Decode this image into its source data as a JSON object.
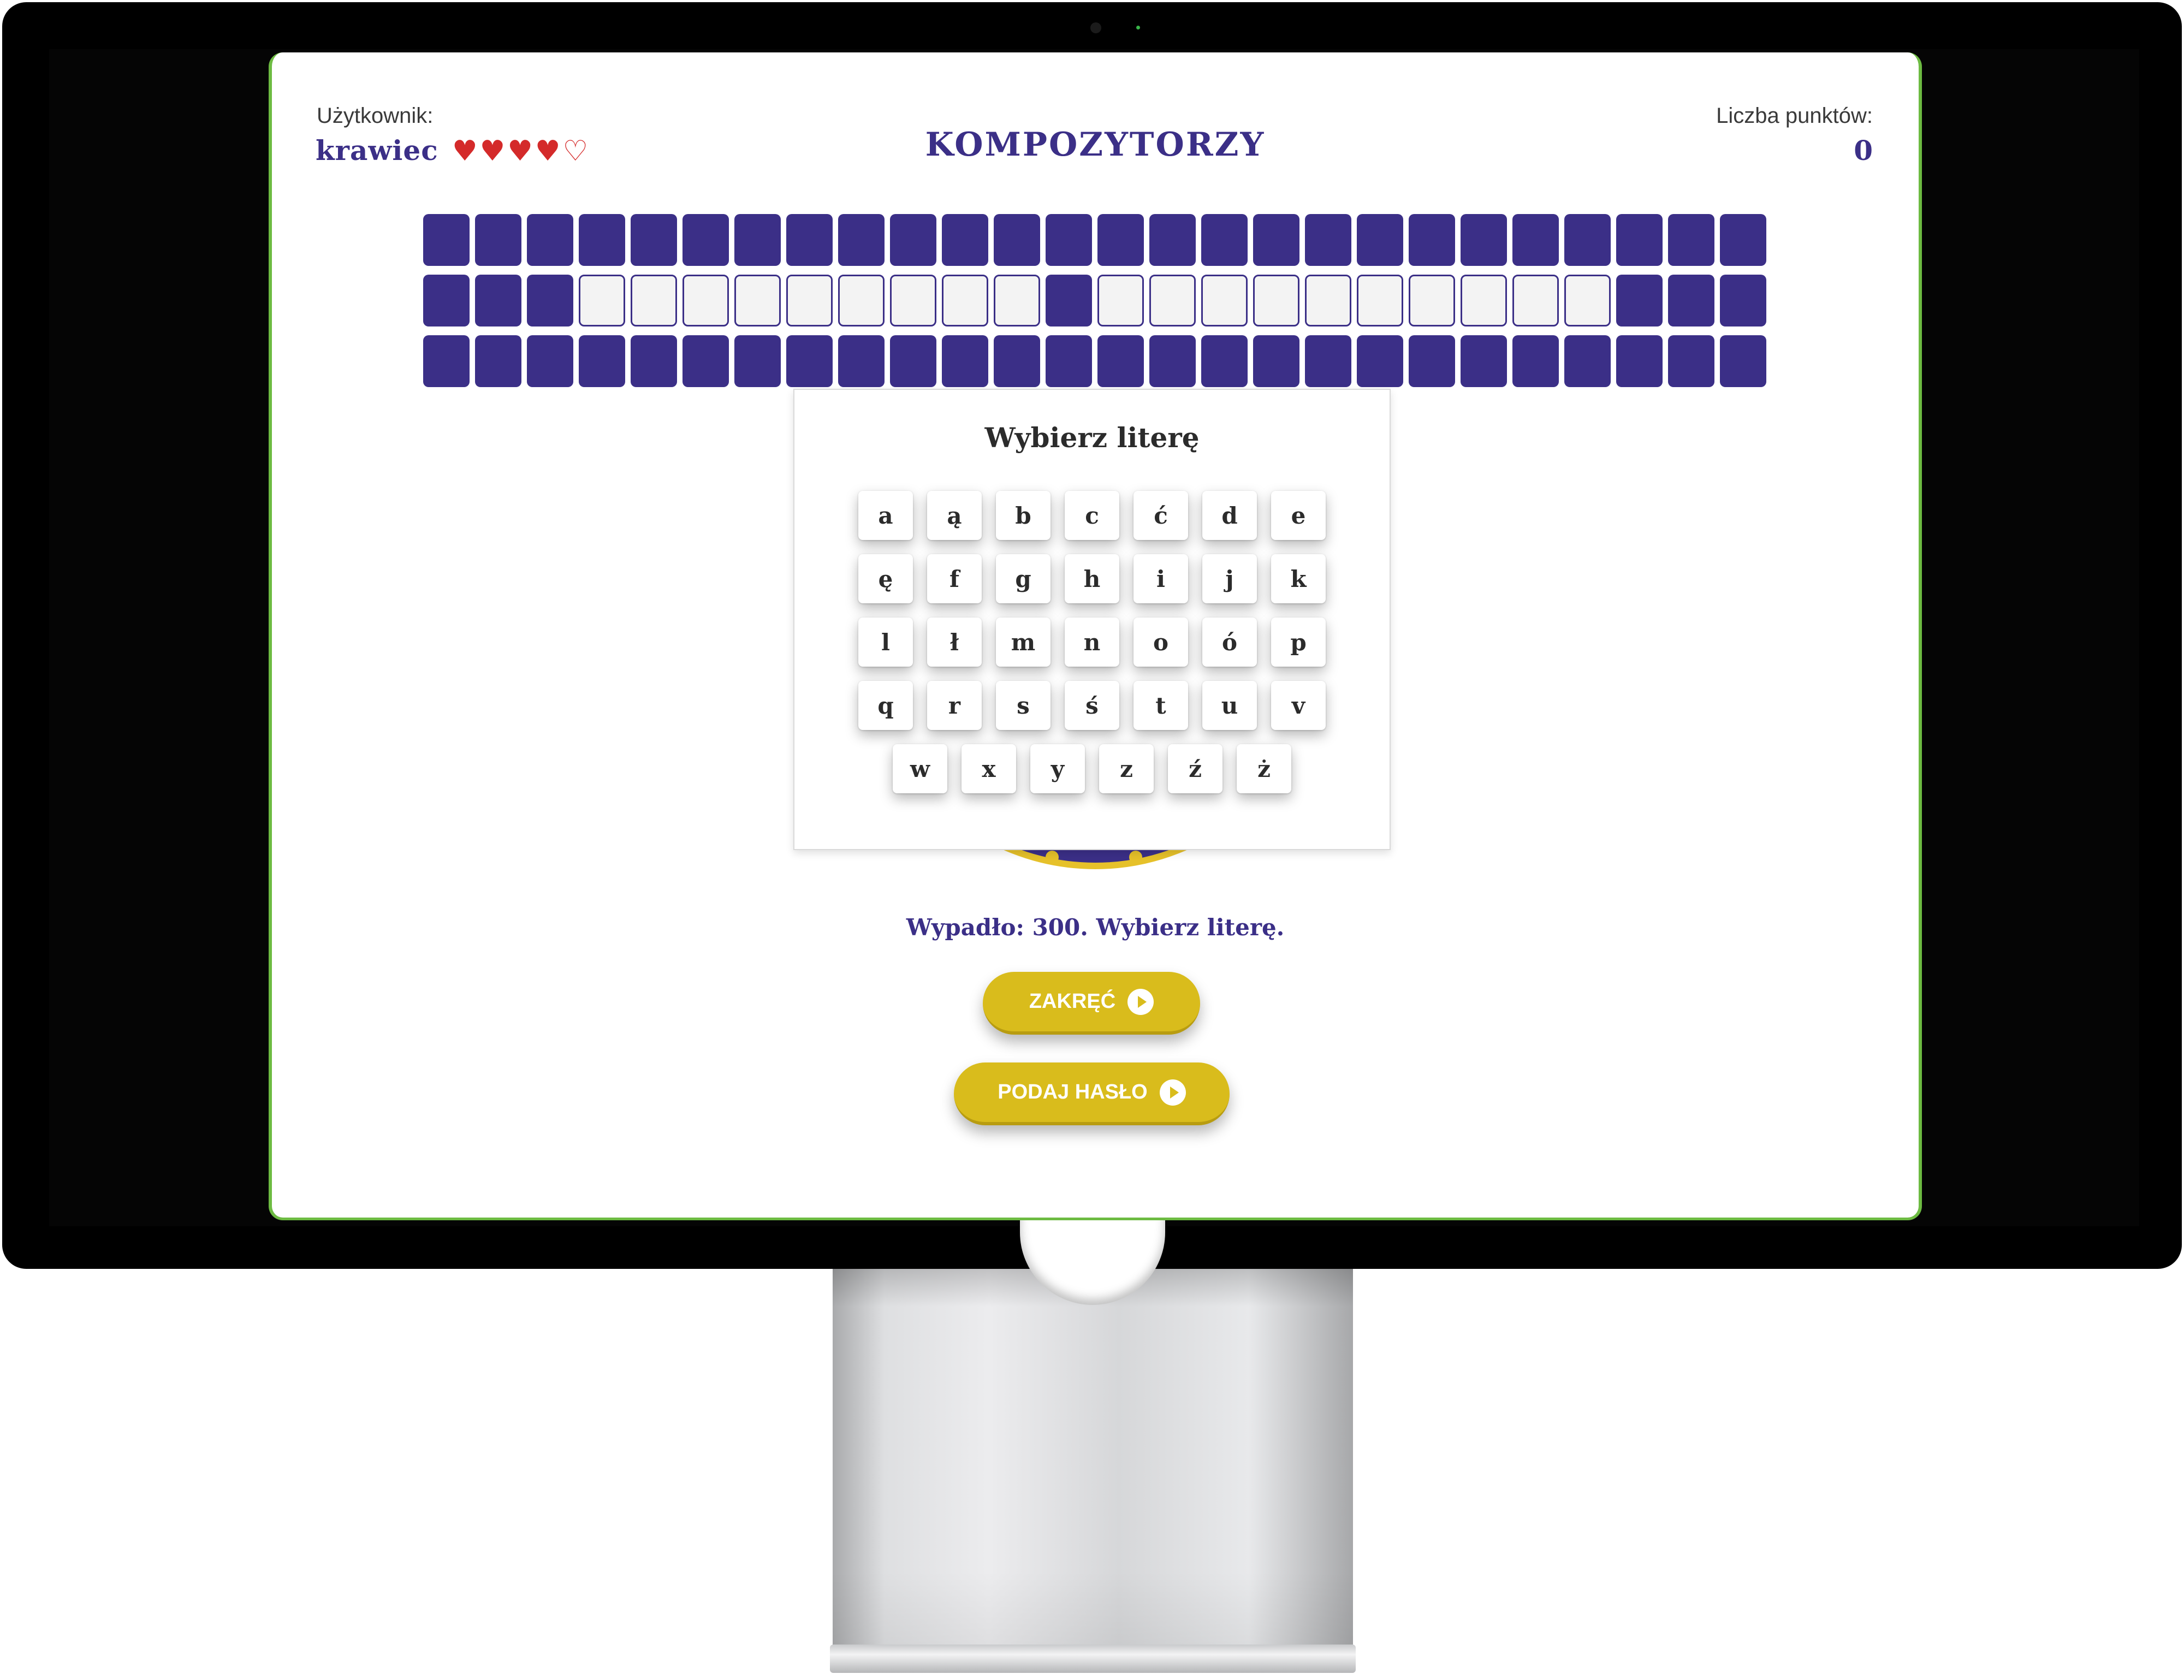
{
  "header": {
    "user_label": "Użytkownik:",
    "user_name": "krawiec",
    "lives_total": 5,
    "lives_remaining": 4,
    "category_title": "KOMPOZYTORZY",
    "points_label": "Liczba punktów:",
    "points_value": "0"
  },
  "board": {
    "columns": 26,
    "rows": [
      "BBBBBBBBBBBBBBBBBBBBBBBBBB",
      "BBBOOOOOOOOOBOOOOOOOOOOBBB",
      "BBBBBBBBBBBBBBBBBBBBBBBBBB"
    ],
    "legend": {
      "B": "hidden-tile",
      "O": "unrevealed-letter-tile"
    }
  },
  "picker": {
    "title": "Wybierz literę",
    "rows": [
      [
        "a",
        "ą",
        "b",
        "c",
        "ć",
        "d",
        "e"
      ],
      [
        "ę",
        "f",
        "g",
        "h",
        "i",
        "j",
        "k"
      ],
      [
        "l",
        "ł",
        "m",
        "n",
        "o",
        "ó",
        "p"
      ],
      [
        "q",
        "r",
        "s",
        "ś",
        "t",
        "u",
        "v"
      ],
      [
        "w",
        "x",
        "y",
        "z",
        "ź",
        "ż"
      ]
    ]
  },
  "status_text": "Wypadło: 300. Wybierz literę.",
  "buttons": {
    "spin_label": "ZAKRĘĆ",
    "guess_label": "PODAJ HASŁO",
    "icon": "play-circle-icon"
  },
  "colors": {
    "brand_navy": "#3b2f87",
    "accent_yellow": "#d9bc1c",
    "heart_red": "#d42a2a",
    "frame_green": "#6dbb42"
  }
}
